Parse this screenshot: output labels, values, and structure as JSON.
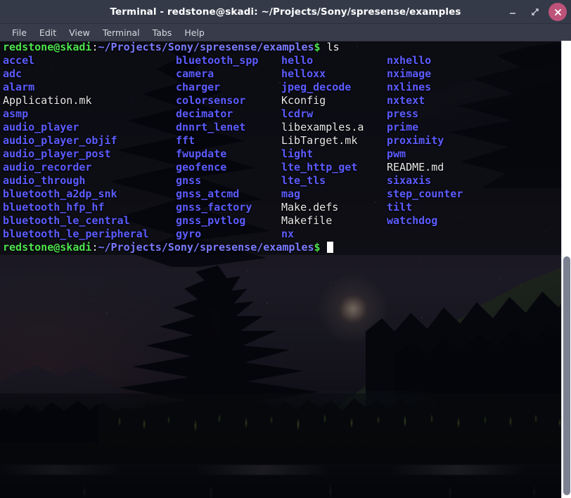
{
  "window": {
    "title": "Terminal - redstone@skadi: ~/Projects/Sony/spresense/examples",
    "buttons": {
      "minimize": "minimize-icon",
      "maximize": "maximize-icon",
      "close": "close-icon"
    }
  },
  "menubar": {
    "items": [
      {
        "label": "File"
      },
      {
        "label": "Edit"
      },
      {
        "label": "View"
      },
      {
        "label": "Terminal"
      },
      {
        "label": "Tabs"
      },
      {
        "label": "Help"
      }
    ]
  },
  "terminal": {
    "prompt": {
      "userhost": "redstone@skadi",
      "colon": ":",
      "path": "~/Projects/Sony/spresense/examples",
      "dollar": "$"
    },
    "command": " ls",
    "cursor": "block-cursor",
    "columns": 4,
    "rows": [
      [
        "accel",
        "bluetooth_spp",
        "hello",
        "nxhello"
      ],
      [
        "adc",
        "camera",
        "helloxx",
        "nximage"
      ],
      [
        "alarm",
        "charger",
        "jpeg_decode",
        "nxlines"
      ],
      [
        "Application.mk",
        "colorsensor",
        "Kconfig",
        "nxtext"
      ],
      [
        "asmp",
        "decimator",
        "lcdrw",
        "press"
      ],
      [
        "audio_player",
        "dnnrt_lenet",
        "libexamples.a",
        "prime"
      ],
      [
        "audio_player_objif",
        "fft",
        "LibTarget.mk",
        "proximity"
      ],
      [
        "audio_player_post",
        "fwupdate",
        "light",
        "pwm"
      ],
      [
        "audio_recorder",
        "geofence",
        "lte_http_get",
        "README.md"
      ],
      [
        "audio_through",
        "gnss",
        "lte_tls",
        "sixaxis"
      ],
      [
        "bluetooth_a2dp_snk",
        "gnss_atcmd",
        "mag",
        "step_counter"
      ],
      [
        "bluetooth_hfp_hf",
        "gnss_factory",
        "Make.defs",
        "tilt"
      ],
      [
        "bluetooth_le_central",
        "gnss_pvtlog",
        "Makefile",
        "watchdog"
      ],
      [
        "bluetooth_le_peripheral",
        "gyro",
        "nx",
        ""
      ]
    ],
    "row_kinds": [
      [
        "dir",
        "dir",
        "dir",
        "dir"
      ],
      [
        "dir",
        "dir",
        "dir",
        "dir"
      ],
      [
        "dir",
        "dir",
        "dir",
        "dir"
      ],
      [
        "file",
        "dir",
        "file",
        "dir"
      ],
      [
        "dir",
        "dir",
        "dir",
        "dir"
      ],
      [
        "dir",
        "dir",
        "file",
        "dir"
      ],
      [
        "dir",
        "dir",
        "file",
        "dir"
      ],
      [
        "dir",
        "dir",
        "dir",
        "dir"
      ],
      [
        "dir",
        "dir",
        "dir",
        "file"
      ],
      [
        "dir",
        "dir",
        "dir",
        "dir"
      ],
      [
        "dir",
        "dir",
        "dir",
        "dir"
      ],
      [
        "dir",
        "dir",
        "file",
        "dir"
      ],
      [
        "dir",
        "dir",
        "file",
        "dir"
      ],
      [
        "dir",
        "dir",
        "dir",
        "file"
      ]
    ]
  },
  "colors": {
    "titlebar_bg": "#353a49",
    "menubar_bg": "#383c4a",
    "close_button": "#bd5379",
    "directory": "#5c5cff",
    "file": "#e8e8e8",
    "prompt_user": "#4ee34e",
    "prompt_path": "#7b7bff",
    "cursor": "#ffffff",
    "scrollbar_track": "#ffffff",
    "scrollbar_thumb": "#7c8191"
  },
  "scrollbar": {
    "name": "vertical-scrollbar"
  }
}
